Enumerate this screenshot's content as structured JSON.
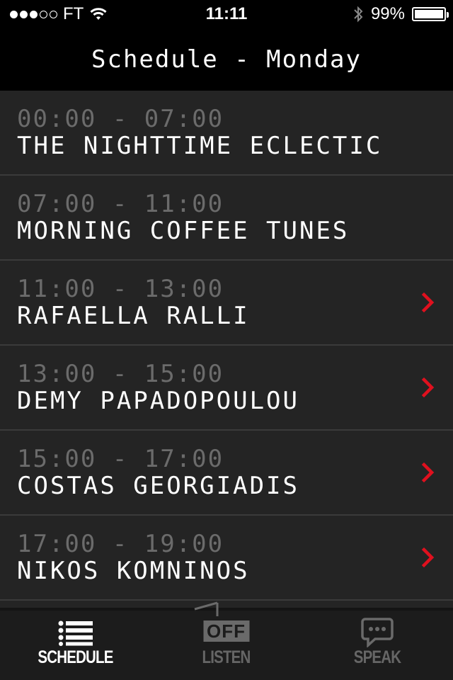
{
  "status_bar": {
    "carrier": "FT",
    "signal_bars_filled": 3,
    "signal_bars_total": 5,
    "time": "11:11",
    "battery": "99%",
    "battery_level": 0.99
  },
  "nav": {
    "title": "Schedule - Monday"
  },
  "schedule": {
    "items": [
      {
        "time": "00:00 - 07:00",
        "title": "THE NIGHTTIME ECLECTIC",
        "has_detail": false
      },
      {
        "time": "07:00 - 11:00",
        "title": "MORNING COFFEE TUNES",
        "has_detail": false
      },
      {
        "time": "11:00 - 13:00",
        "title": "RAFAELLA RALLI",
        "has_detail": true
      },
      {
        "time": "13:00 - 15:00",
        "title": "DEMY PAPADOPOULOU",
        "has_detail": true
      },
      {
        "time": "15:00 - 17:00",
        "title": "COSTAS GEORGIADIS",
        "has_detail": true
      },
      {
        "time": "17:00 - 19:00",
        "title": "NIKOS KOMNINOS",
        "has_detail": true
      }
    ]
  },
  "tabs": {
    "schedule": {
      "label": "SCHEDULE",
      "icon": "list-icon"
    },
    "listen": {
      "label": "LISTEN",
      "badge": "OFF",
      "icon": "radio-icon"
    },
    "speak": {
      "label": "SPEAK",
      "icon": "chat-bubble-icon"
    }
  },
  "colors": {
    "accent": "#e0101e",
    "background": "#242424",
    "time_text": "#6b6b6b"
  }
}
